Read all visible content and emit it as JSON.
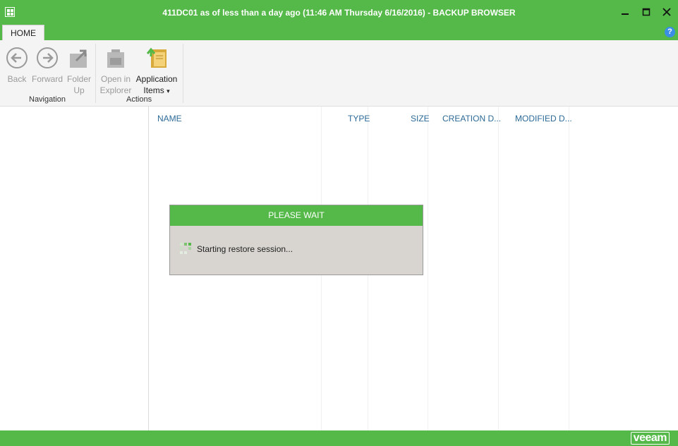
{
  "window": {
    "title": "411DC01 as of less than a day ago (11:46 AM Thursday 6/16/2016) - BACKUP BROWSER",
    "app_icon": "grid-app-icon",
    "controls": {
      "minimize": "✕",
      "maximize": "□",
      "close": "✕"
    }
  },
  "ribbon": {
    "tabs": [
      {
        "label": "HOME",
        "active": true
      }
    ],
    "help_label": "?",
    "groups": [
      {
        "label": "Navigation",
        "buttons": [
          {
            "line1": "Back",
            "line2": "",
            "enabled": false,
            "icon": "arrow-left-icon"
          },
          {
            "line1": "Forward",
            "line2": "",
            "enabled": false,
            "icon": "arrow-right-icon"
          },
          {
            "line1": "Folder",
            "line2": "Up",
            "enabled": false,
            "icon": "folder-up-icon"
          }
        ]
      },
      {
        "label": "Actions",
        "buttons": [
          {
            "line1": "Open in",
            "line2": "Explorer",
            "enabled": false,
            "icon": "open-explorer-icon"
          },
          {
            "line1": "Application",
            "line2": "Items",
            "enabled": true,
            "icon": "application-items-icon",
            "dropdown": "▾"
          }
        ]
      }
    ]
  },
  "file_list": {
    "columns": [
      "NAME",
      "TYPE",
      "SIZE",
      "CREATION D...",
      "MODIFIED D..."
    ]
  },
  "dialog": {
    "title": "PLEASE WAIT",
    "message": "Starting restore session...",
    "icon": "loading-spinner-icon"
  },
  "statusbar": {
    "brand": "veeam"
  },
  "colors": {
    "accent": "#54b948",
    "header_text": "#2c6a97",
    "dialog_bg": "#d8d5d0"
  }
}
